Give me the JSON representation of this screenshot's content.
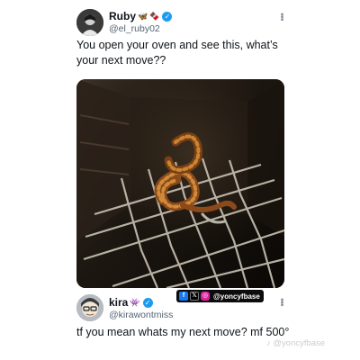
{
  "tweet": {
    "display_name": "Ruby",
    "name_emoji": [
      "🦋",
      "🍫"
    ],
    "handle": "@el_ruby02",
    "text": "You open your oven and see this, what’s your next move??",
    "media_description_icon": "snake-in-oven-photo",
    "more_icon": "more-vertical-icon"
  },
  "reply": {
    "display_name": "kira",
    "name_emoji": [
      "👾"
    ],
    "handle": "@kirawontmiss",
    "text": "tf you mean whats my next move? mf 500°"
  },
  "social_tag": {
    "icons": [
      "facebook-icon",
      "x-icon",
      "instagram-icon"
    ],
    "text": "@yoncyfbase"
  },
  "watermark": {
    "text": "@yoncyfbase",
    "icon": "tiktok-icon"
  },
  "colors": {
    "verified": "#1d9bf0",
    "text_primary": "#0f1419",
    "text_secondary": "#536471",
    "background": "#ffffff"
  }
}
